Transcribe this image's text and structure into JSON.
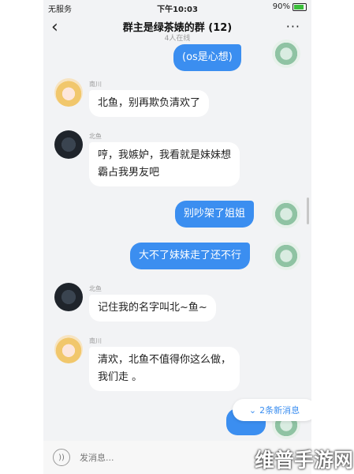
{
  "status_bar": {
    "carrier": "无服务",
    "time": "下午10:03",
    "battery": "90%"
  },
  "header": {
    "title": "群主是绿茶婊的群 (12)",
    "subtitle": "4人在线",
    "back_icon": "chevron-left-icon",
    "more_icon": "more-icon"
  },
  "messages": [
    {
      "side": "right",
      "text": "(os是心想)"
    },
    {
      "side": "left",
      "sender": "南川",
      "text": "北鱼，别再欺负清欢了"
    },
    {
      "side": "left",
      "sender": "北鱼",
      "line1": "哼，我嫉妒，我看就是妹妹想",
      "line2": "霸占我男友吧"
    },
    {
      "side": "right",
      "text": "别吵架了姐姐"
    },
    {
      "side": "right",
      "text": "大不了妹妹走了还不行"
    },
    {
      "side": "left",
      "sender": "北鱼",
      "text": "记住我的名字叫北~鱼~"
    },
    {
      "side": "left",
      "sender": "南川",
      "line1": "清欢，北鱼不值得你这么做，",
      "line2": "我们走 。"
    }
  ],
  "new_messages": {
    "label": "2条新消息",
    "icon": "double-chevron-down-icon"
  },
  "input_bar": {
    "placeholder": "发消息...",
    "voice_icon": "voice-icon"
  },
  "watermark": "维普手游网"
}
